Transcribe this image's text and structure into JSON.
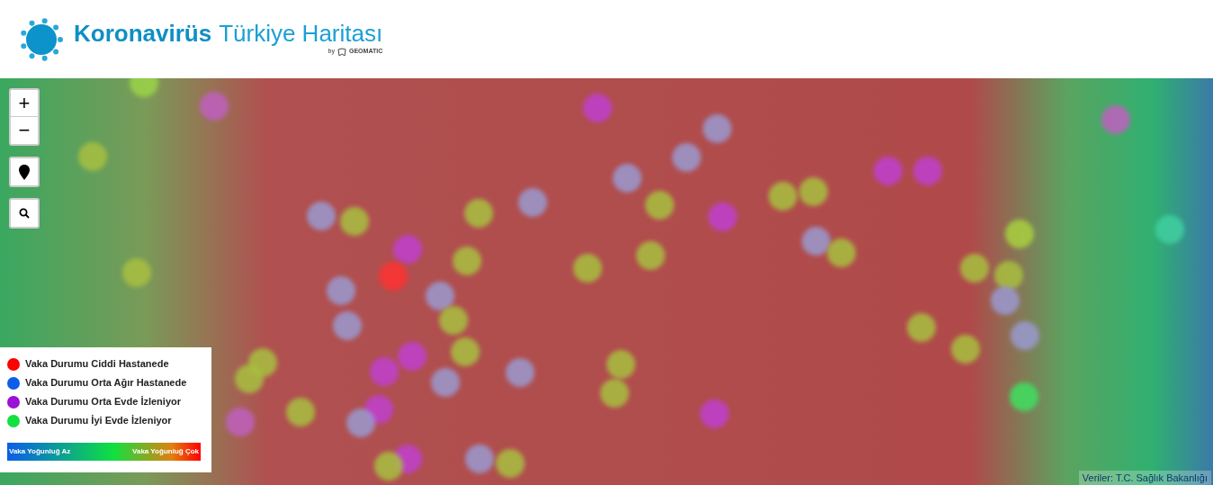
{
  "header": {
    "title_bold": "Koronavirüs",
    "title_light": "Türkiye Haritası",
    "byline": "by",
    "brand": "GEOMATIC"
  },
  "map_controls": {
    "zoom_in": "+",
    "zoom_out": "−"
  },
  "legend": {
    "items": [
      {
        "label": "Vaka Durumu Ciddi Hastanede",
        "color": "#ff0000"
      },
      {
        "label": "Vaka Durumu Orta Ağır Hastanede",
        "color": "#0a5ee8"
      },
      {
        "label": "Vaka Durumu Orta Evde İzleniyor",
        "color": "#9b0fd8"
      },
      {
        "label": "Vaka Durumu İyi Evde İzleniyor",
        "color": "#12e040"
      }
    ],
    "scale_low": "Vaka Yoğunluğ Az",
    "scale_high": "Vaka Yoğunluğ Çok"
  },
  "attribution": "Veriler: T.C. Sağlık Bakanlığı"
}
